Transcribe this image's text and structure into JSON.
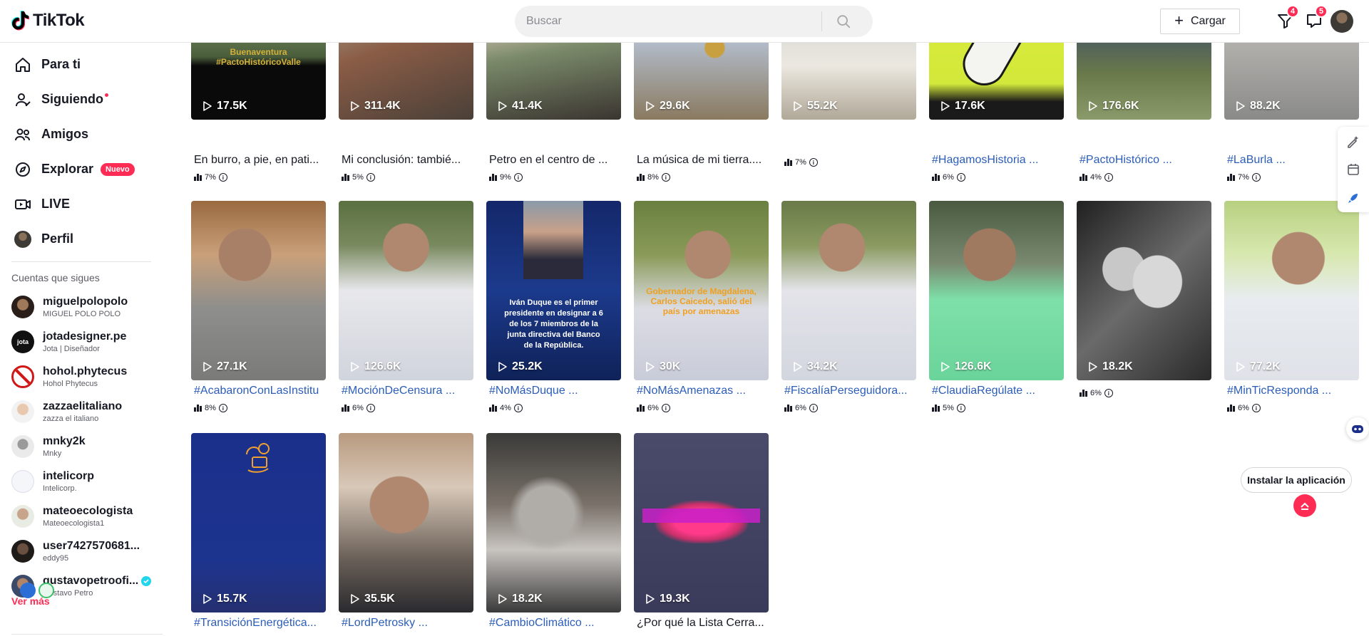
{
  "header": {
    "logo_text": "TikTok",
    "search_placeholder": "Buscar",
    "upload_label": "Cargar",
    "inbox_badge": "4",
    "messages_badge": "5"
  },
  "sidebar": {
    "nav": [
      {
        "label": "Para ti",
        "icon": "home-icon"
      },
      {
        "label": "Siguiendo",
        "icon": "following-icon"
      },
      {
        "label": "Amigos",
        "icon": "friends-icon"
      },
      {
        "label": "Explorar",
        "icon": "compass-icon",
        "badge": "Nuevo"
      },
      {
        "label": "LIVE",
        "icon": "live-icon"
      },
      {
        "label": "Perfil",
        "icon": "profile-avatar"
      }
    ],
    "following_title": "Cuentas que sigues",
    "accounts": [
      {
        "user": "miguelpolopolo",
        "nick": "MIGUEL POLO POLO"
      },
      {
        "user": "jotadesigner.pe",
        "nick": "Jota | Diseñador"
      },
      {
        "user": "hohol.phytecus",
        "nick": "Hohol Phytecus"
      },
      {
        "user": "zazzaelitaliano",
        "nick": "zazza el italiano"
      },
      {
        "user": "mnky2k",
        "nick": "Mnky"
      },
      {
        "user": "intelicorp",
        "nick": "Intelicorp."
      },
      {
        "user": "mateoecologista",
        "nick": "Mateoecologista1"
      },
      {
        "user": "user7427570681...",
        "nick": "eddy95"
      },
      {
        "user": "gustavopetroofi...",
        "nick": "Gustavo Petro"
      }
    ],
    "see_more": "Ver más"
  },
  "videos": [
    {
      "plays": "17.5K",
      "caption": "En burro, a pie, en pati...",
      "tag": false,
      "stat": "7%",
      "overlay": "Buenaventura #PactoHistóricoValle"
    },
    {
      "plays": "311.4K",
      "caption": "Mi conclusión: tambié...",
      "tag": false,
      "stat": "5%"
    },
    {
      "plays": "41.4K",
      "caption": "Petro en el centro de ...",
      "tag": false,
      "stat": "9%"
    },
    {
      "plays": "29.6K",
      "caption": "La música de mi tierra....",
      "tag": false,
      "stat": "8%"
    },
    {
      "plays": "55.2K",
      "caption": "",
      "tag": false,
      "stat": "7%"
    },
    {
      "plays": "17.6K",
      "caption": "#HagamosHistoria ...",
      "tag": true,
      "stat": "6%"
    },
    {
      "plays": "176.6K",
      "caption": "#PactoHistórico ...",
      "tag": true,
      "stat": "4%"
    },
    {
      "plays": "88.2K",
      "caption": "#LaBurla ...",
      "tag": true,
      "stat": "7%"
    },
    {
      "plays": "27.1K",
      "caption": "#AcabaronConLasInstitu",
      "tag": true,
      "stat": "8%"
    },
    {
      "plays": "126.6K",
      "caption": "#MociónDeCensura ...",
      "tag": true,
      "stat": "6%"
    },
    {
      "plays": "25.2K",
      "caption": "#NoMásDuque ...",
      "tag": true,
      "stat": "4%",
      "overlay": "Iván Duque es el primer presidente en designar a 6 de los 7 miembros de la junta directiva del Banco de la República."
    },
    {
      "plays": "30K",
      "caption": "#NoMásAmenazas ...",
      "tag": true,
      "stat": "6%",
      "overlay": "Gobernador de Magdalena, Carlos Caicedo, salió del país por amenazas"
    },
    {
      "plays": "34.2K",
      "caption": "#FiscalíaPerseguidora...",
      "tag": true,
      "stat": "6%"
    },
    {
      "plays": "126.6K",
      "caption": "#ClaudiaRegúlate ...",
      "tag": true,
      "stat": "5%"
    },
    {
      "plays": "18.2K",
      "caption": "",
      "tag": false,
      "stat": "6%"
    },
    {
      "plays": "77.2K",
      "caption": "#MinTicResponda ...",
      "tag": true,
      "stat": "6%"
    },
    {
      "plays": "15.7K",
      "caption": "#TransiciónEnergética...",
      "tag": true,
      "stat": ""
    },
    {
      "plays": "35.5K",
      "caption": "#LordPetrosky ...",
      "tag": true,
      "stat": ""
    },
    {
      "plays": "18.2K",
      "caption": "#CambioClimático ...",
      "tag": true,
      "stat": ""
    },
    {
      "plays": "19.3K",
      "caption": "¿Por qué la Lista Cerra...",
      "tag": false,
      "stat": ""
    }
  ],
  "install_label": "Instalar la aplicación",
  "colors": {
    "accent": "#fe2c55",
    "hashtag": "#2b5db9",
    "verified": "#20d5ec"
  }
}
